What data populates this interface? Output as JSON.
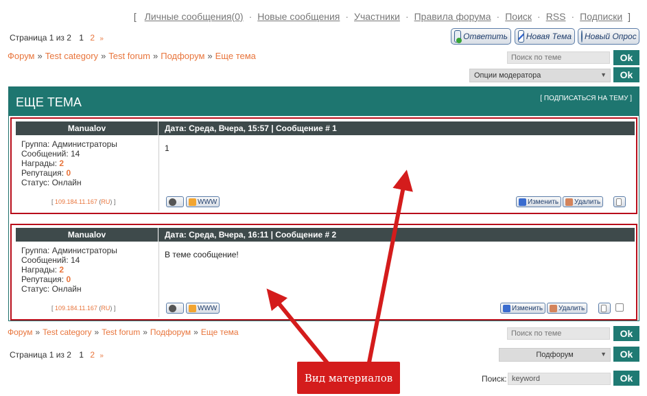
{
  "topnav": {
    "open_bracket": "[",
    "items": [
      "Личные сообщения(0)",
      "Новые сообщения",
      "Участники",
      "Правила форума",
      "Поиск",
      "RSS",
      "Подписки"
    ],
    "sep": "·",
    "close_bracket": "]"
  },
  "pager": {
    "label": "Страница 1 из 2",
    "current": "1",
    "next_page": "2",
    "next_arrow": "»"
  },
  "actions": {
    "reply": "Ответить",
    "new_topic": "Новая Тема",
    "new_poll": "Новый Опрос"
  },
  "breadcrumb": {
    "items": [
      "Форум",
      "Test category",
      "Test forum",
      "Подфорум",
      "Еще тема"
    ],
    "sep": "»"
  },
  "topic_search": {
    "placeholder": "Поиск по теме",
    "ok": "Ok"
  },
  "moderator": {
    "selected": "Опции модератора",
    "ok": "Ok"
  },
  "topic": {
    "title": "ЕЩЕ ТЕМА",
    "subscribe": "[ ПОДПИСАТЬСЯ НА ТЕМУ ]"
  },
  "posts": [
    {
      "author": "Manualov",
      "meta": "Дата: Среда, Вчера, 15:57 | Сообщение # 1",
      "group": "Группа: Администраторы",
      "messages": "Сообщений: 14",
      "awards_label": "Награды: ",
      "awards": "2",
      "rep_label": "Репутация: ",
      "rep": "0",
      "status": "Статус: Онлайн",
      "ip_open": "[ ",
      "ip": "109.184.11.167",
      "country": "RU",
      "ip_close": " ]",
      "text": "1",
      "www": "WWW",
      "edit": "Изменить",
      "delete": "Удалить"
    },
    {
      "author": "Manualov",
      "meta": "Дата: Среда, Вчера, 16:11 | Сообщение # 2",
      "group": "Группа: Администраторы",
      "messages": "Сообщений: 14",
      "awards_label": "Награды: ",
      "awards": "2",
      "rep_label": "Репутация: ",
      "rep": "0",
      "status": "Статус: Онлайн",
      "ip_open": "[ ",
      "ip": "109.184.11.167",
      "country": "RU",
      "ip_close": " ]",
      "text": "В теме сообщение!",
      "www": "WWW",
      "edit": "Изменить",
      "delete": "Удалить"
    }
  ],
  "bottom": {
    "search_placeholder": "Поиск по теме",
    "ok": "Ok",
    "forum_select": "Подфорум",
    "search_label": "Поиск:",
    "search_value": "keyword"
  },
  "annotation": {
    "label": "Вид материалов"
  },
  "colors": {
    "accent": "#1e7670",
    "link": "#e8743b",
    "highlight": "#d41c1c"
  }
}
